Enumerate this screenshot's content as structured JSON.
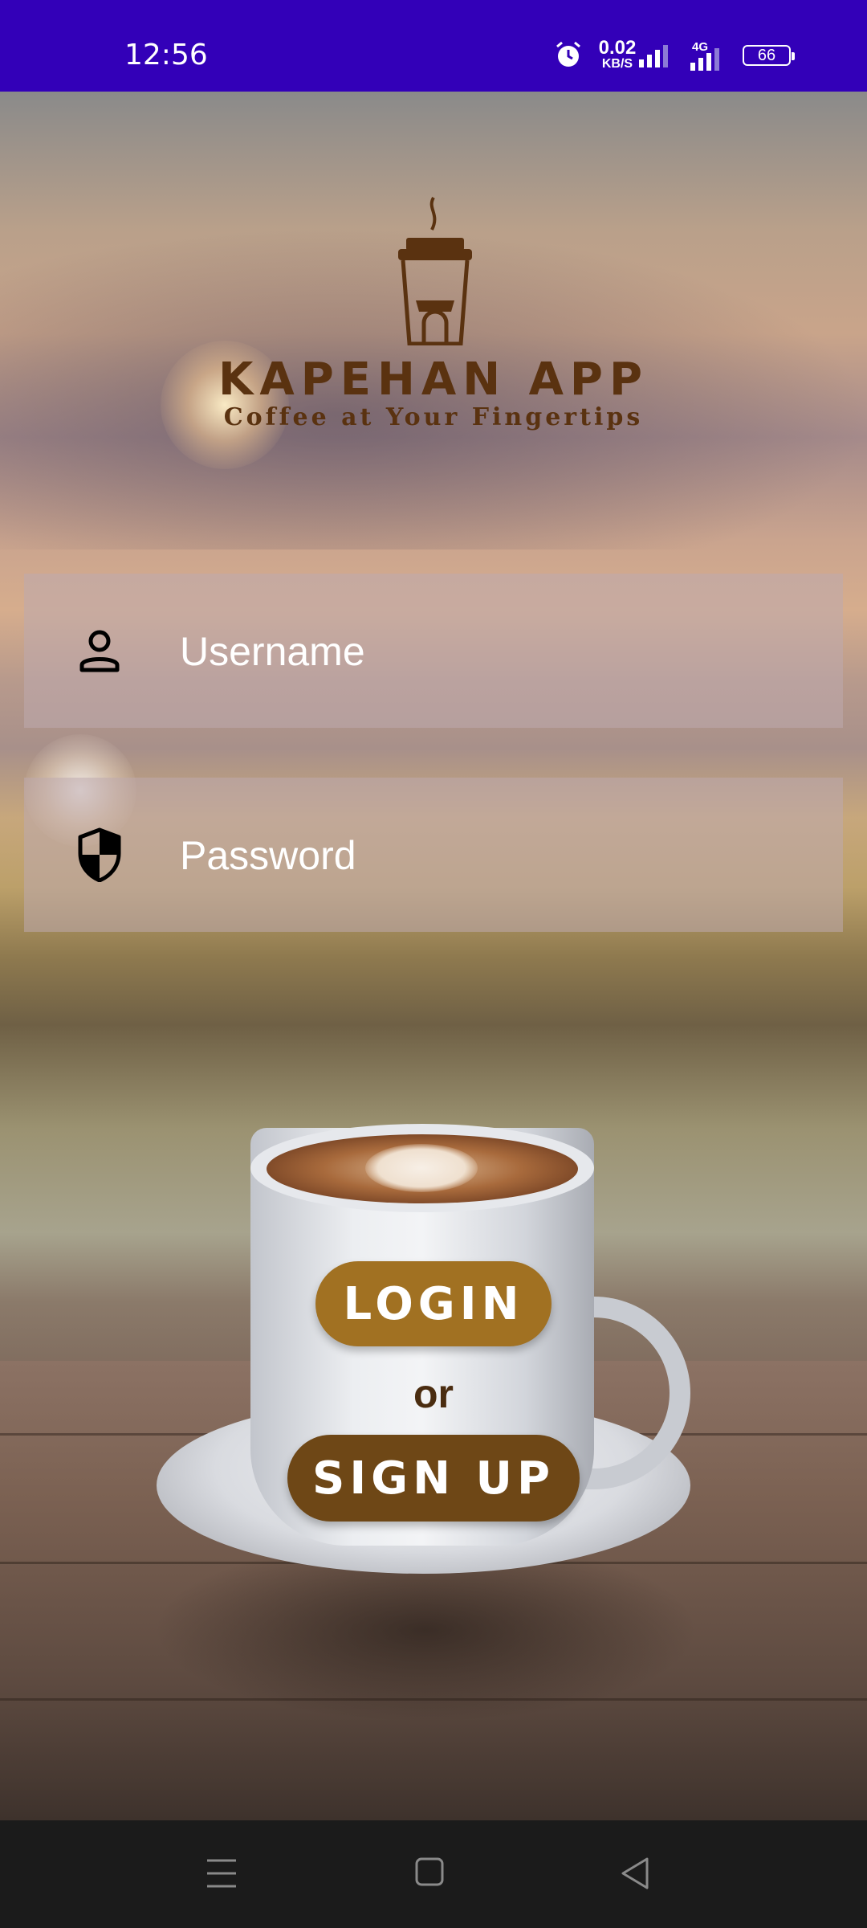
{
  "status_bar": {
    "time": "12:56",
    "speed_value": "0.02",
    "speed_unit": "KB/S",
    "network": "4G",
    "battery": "66",
    "background_color": "#3300b8"
  },
  "logo": {
    "title": "KAPEHAN APP",
    "subtitle": "Coffee at Your Fingertips",
    "color": "#5a3210",
    "icon": "coffee-cup-logo-icon"
  },
  "form": {
    "username": {
      "placeholder": "Username",
      "value": "",
      "icon": "person-icon"
    },
    "password": {
      "placeholder": "Password",
      "value": "",
      "icon": "shield-icon"
    }
  },
  "actions": {
    "login_label": "LOGIN",
    "or_label": "or",
    "signup_label": "SIGN UP",
    "login_color": "#a17122",
    "signup_color": "#6e4716"
  },
  "nav_bar": {
    "icons": [
      "menu-icon",
      "home-square-icon",
      "back-triangle-icon"
    ]
  }
}
